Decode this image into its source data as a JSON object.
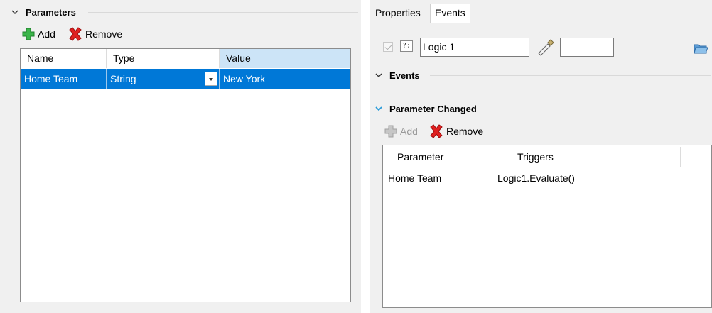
{
  "parameters": {
    "section_title": "Parameters",
    "add_label": "Add",
    "remove_label": "Remove",
    "columns": [
      "Name",
      "Type",
      "Value"
    ],
    "row": {
      "name": "Home Team",
      "type": "String",
      "value": "New York"
    }
  },
  "right": {
    "tabs": [
      "Properties",
      "Events"
    ],
    "active_tab": "Events",
    "logic_name": "Logic 1",
    "events_title": "Events",
    "param_changed_title": "Parameter Changed",
    "add_label": "Add",
    "remove_label": "Remove",
    "columns": [
      "Parameter",
      "Triggers"
    ],
    "row": {
      "parameter": "Home Team",
      "trigger": "Logic1.Evaluate()"
    }
  },
  "colors": {
    "selection": "#0078d7",
    "header_selected": "#cce4f7",
    "accent_chevron": "#2a9bd8",
    "add_green": "#3bb54a",
    "remove_red": "#e02020"
  },
  "icons": [
    "chevron-down-icon",
    "add-plus-icon",
    "remove-x-icon",
    "checkbox-icon",
    "question-box-icon",
    "eyedropper-icon",
    "folder-icon"
  ]
}
